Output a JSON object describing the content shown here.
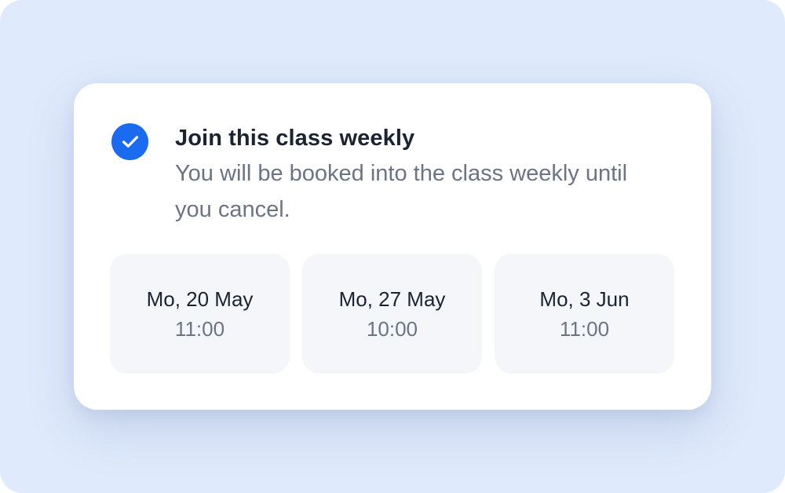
{
  "colors": {
    "background": "#dfeafc",
    "card": "#ffffff",
    "accent": "#1a6bf0",
    "session_bg": "#f4f6fa",
    "title_text": "#1b2232",
    "secondary_text": "#6b7385"
  },
  "option": {
    "checked": true,
    "icon": "check-circle-icon",
    "title": "Join this class weekly",
    "description": "You will be booked into the class weekly until you cancel."
  },
  "sessions": [
    {
      "date": "Mo, 20 May",
      "time": "11:00"
    },
    {
      "date": "Mo, 27 May",
      "time": "10:00"
    },
    {
      "date": "Mo, 3 Jun",
      "time": "11:00"
    }
  ]
}
